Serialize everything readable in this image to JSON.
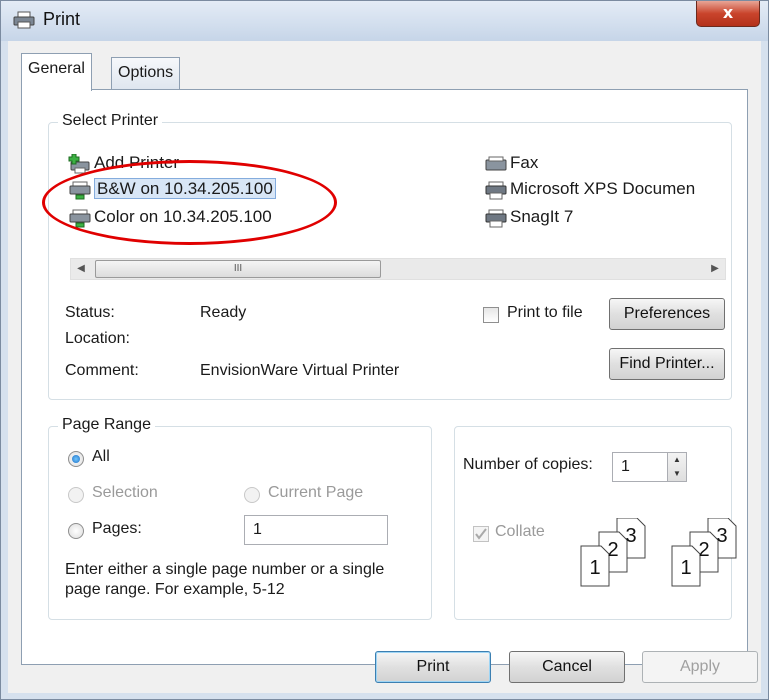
{
  "window": {
    "title": "Print",
    "close_glyph": "x"
  },
  "tabs": [
    {
      "label": "General",
      "active": true
    },
    {
      "label": "Options",
      "active": false
    }
  ],
  "select_printer": {
    "group_title": "Select Printer",
    "printers_left": [
      {
        "label": "Add Printer",
        "icon": "add-printer-icon"
      },
      {
        "label": "B&W on 10.34.205.100",
        "icon": "network-printer-icon",
        "selected": true
      },
      {
        "label": "Color on 10.34.205.100",
        "icon": "network-printer-icon"
      }
    ],
    "printers_right": [
      {
        "label": "Fax",
        "icon": "fax-icon"
      },
      {
        "label": "Microsoft XPS Documen",
        "icon": "printer-icon"
      },
      {
        "label": "SnagIt 7",
        "icon": "printer-icon"
      }
    ],
    "scroll_grip": "III",
    "status_label": "Status:",
    "status_value": "Ready",
    "location_label": "Location:",
    "location_value": "",
    "comment_label": "Comment:",
    "comment_value": "EnvisionWare Virtual Printer",
    "print_to_file_label": "Print to file",
    "print_to_file_checked": false,
    "preferences_label": "Preferences",
    "find_printer_label": "Find Printer..."
  },
  "page_range": {
    "group_title": "Page Range",
    "all_label": "All",
    "selection_label": "Selection",
    "current_page_label": "Current Page",
    "pages_label": "Pages:",
    "pages_value": "1",
    "help_line1": "Enter either a single page number or a single",
    "help_line2": "page range.  For example, 5-12"
  },
  "copies": {
    "label": "Number of copies:",
    "value": "1",
    "collate_label": "Collate",
    "collate_checked": true,
    "collate_digits": [
      "1",
      "2",
      "3"
    ]
  },
  "buttons": {
    "print": "Print",
    "cancel": "Cancel",
    "apply": "Apply"
  },
  "colors": {
    "highlight_circle": "#e00000",
    "selection_bg": "#d8e6f6",
    "title_gradient": "#c6d5e8"
  }
}
